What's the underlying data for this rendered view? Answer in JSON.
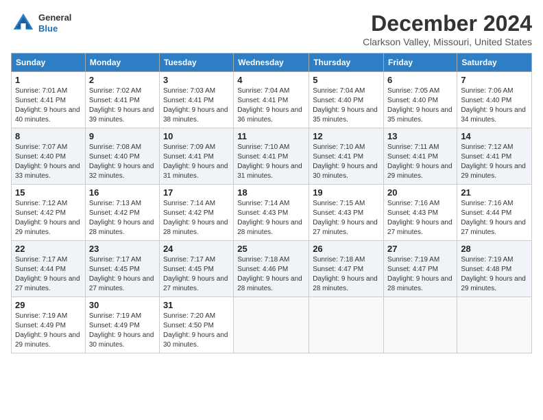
{
  "header": {
    "logo_line1": "General",
    "logo_line2": "Blue",
    "month_title": "December 2024",
    "location": "Clarkson Valley, Missouri, United States"
  },
  "days_of_week": [
    "Sunday",
    "Monday",
    "Tuesday",
    "Wednesday",
    "Thursday",
    "Friday",
    "Saturday"
  ],
  "weeks": [
    [
      {
        "day": "1",
        "sunrise": "7:01 AM",
        "sunset": "4:41 PM",
        "daylight": "9 hours and 40 minutes."
      },
      {
        "day": "2",
        "sunrise": "7:02 AM",
        "sunset": "4:41 PM",
        "daylight": "9 hours and 39 minutes."
      },
      {
        "day": "3",
        "sunrise": "7:03 AM",
        "sunset": "4:41 PM",
        "daylight": "9 hours and 38 minutes."
      },
      {
        "day": "4",
        "sunrise": "7:04 AM",
        "sunset": "4:41 PM",
        "daylight": "9 hours and 36 minutes."
      },
      {
        "day": "5",
        "sunrise": "7:04 AM",
        "sunset": "4:40 PM",
        "daylight": "9 hours and 35 minutes."
      },
      {
        "day": "6",
        "sunrise": "7:05 AM",
        "sunset": "4:40 PM",
        "daylight": "9 hours and 35 minutes."
      },
      {
        "day": "7",
        "sunrise": "7:06 AM",
        "sunset": "4:40 PM",
        "daylight": "9 hours and 34 minutes."
      }
    ],
    [
      {
        "day": "8",
        "sunrise": "7:07 AM",
        "sunset": "4:40 PM",
        "daylight": "9 hours and 33 minutes."
      },
      {
        "day": "9",
        "sunrise": "7:08 AM",
        "sunset": "4:40 PM",
        "daylight": "9 hours and 32 minutes."
      },
      {
        "day": "10",
        "sunrise": "7:09 AM",
        "sunset": "4:41 PM",
        "daylight": "9 hours and 31 minutes."
      },
      {
        "day": "11",
        "sunrise": "7:10 AM",
        "sunset": "4:41 PM",
        "daylight": "9 hours and 31 minutes."
      },
      {
        "day": "12",
        "sunrise": "7:10 AM",
        "sunset": "4:41 PM",
        "daylight": "9 hours and 30 minutes."
      },
      {
        "day": "13",
        "sunrise": "7:11 AM",
        "sunset": "4:41 PM",
        "daylight": "9 hours and 29 minutes."
      },
      {
        "day": "14",
        "sunrise": "7:12 AM",
        "sunset": "4:41 PM",
        "daylight": "9 hours and 29 minutes."
      }
    ],
    [
      {
        "day": "15",
        "sunrise": "7:12 AM",
        "sunset": "4:42 PM",
        "daylight": "9 hours and 29 minutes."
      },
      {
        "day": "16",
        "sunrise": "7:13 AM",
        "sunset": "4:42 PM",
        "daylight": "9 hours and 28 minutes."
      },
      {
        "day": "17",
        "sunrise": "7:14 AM",
        "sunset": "4:42 PM",
        "daylight": "9 hours and 28 minutes."
      },
      {
        "day": "18",
        "sunrise": "7:14 AM",
        "sunset": "4:43 PM",
        "daylight": "9 hours and 28 minutes."
      },
      {
        "day": "19",
        "sunrise": "7:15 AM",
        "sunset": "4:43 PM",
        "daylight": "9 hours and 27 minutes."
      },
      {
        "day": "20",
        "sunrise": "7:16 AM",
        "sunset": "4:43 PM",
        "daylight": "9 hours and 27 minutes."
      },
      {
        "day": "21",
        "sunrise": "7:16 AM",
        "sunset": "4:44 PM",
        "daylight": "9 hours and 27 minutes."
      }
    ],
    [
      {
        "day": "22",
        "sunrise": "7:17 AM",
        "sunset": "4:44 PM",
        "daylight": "9 hours and 27 minutes."
      },
      {
        "day": "23",
        "sunrise": "7:17 AM",
        "sunset": "4:45 PM",
        "daylight": "9 hours and 27 minutes."
      },
      {
        "day": "24",
        "sunrise": "7:17 AM",
        "sunset": "4:45 PM",
        "daylight": "9 hours and 27 minutes."
      },
      {
        "day": "25",
        "sunrise": "7:18 AM",
        "sunset": "4:46 PM",
        "daylight": "9 hours and 28 minutes."
      },
      {
        "day": "26",
        "sunrise": "7:18 AM",
        "sunset": "4:47 PM",
        "daylight": "9 hours and 28 minutes."
      },
      {
        "day": "27",
        "sunrise": "7:19 AM",
        "sunset": "4:47 PM",
        "daylight": "9 hours and 28 minutes."
      },
      {
        "day": "28",
        "sunrise": "7:19 AM",
        "sunset": "4:48 PM",
        "daylight": "9 hours and 29 minutes."
      }
    ],
    [
      {
        "day": "29",
        "sunrise": "7:19 AM",
        "sunset": "4:49 PM",
        "daylight": "9 hours and 29 minutes."
      },
      {
        "day": "30",
        "sunrise": "7:19 AM",
        "sunset": "4:49 PM",
        "daylight": "9 hours and 30 minutes."
      },
      {
        "day": "31",
        "sunrise": "7:20 AM",
        "sunset": "4:50 PM",
        "daylight": "9 hours and 30 minutes."
      },
      null,
      null,
      null,
      null
    ]
  ]
}
